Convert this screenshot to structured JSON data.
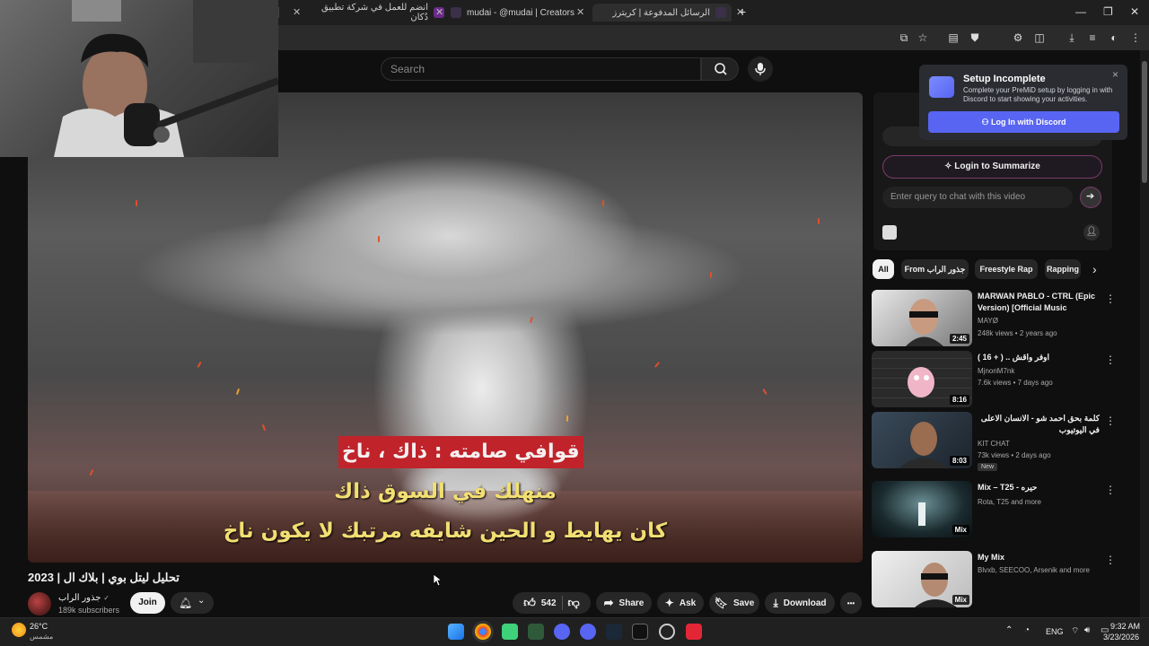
{
  "browser": {
    "tabs": [
      {
        "label": "انضم للعمل في شركة تطبيق دُكان"
      },
      {
        "label": "mudai - @mudai | Creators"
      },
      {
        "label": "الرسائل المدفوعة | كريترز"
      }
    ],
    "new_tab": "+",
    "window_controls": {
      "minimize": "—",
      "maximize": "❐",
      "close": "✕"
    }
  },
  "youtube": {
    "search": {
      "placeholder": "Search"
    }
  },
  "video": {
    "subtitles": {
      "line1": "قوافي صامته : ذاك ، ناخ",
      "line2": "منهلك في السوق ذاك",
      "line3": "كان يهايط و الحين شايفه مرتبك لا يكون ناخ"
    },
    "title": "تحليل ليتل بوي | بلاك ال | 2023",
    "channel": {
      "name": "جذور الراب",
      "subscribers": "189k subscribers",
      "verified": "✓"
    },
    "actions": {
      "join": "Join",
      "likes": "542",
      "share": "Share",
      "ask": "Ask",
      "save": "Save",
      "download": "Download",
      "more": "•••"
    }
  },
  "extension": {
    "login_summarize": "Login to Summarize",
    "chat_placeholder": "Enter query to chat with this video"
  },
  "premid": {
    "title": "Setup Incomplete",
    "description": "Complete your PreMiD setup by logging in with Discord to start showing your activities.",
    "button": "Log In with Discord",
    "close": "×"
  },
  "chips": [
    {
      "label": "All"
    },
    {
      "label": "From جذور الراب"
    },
    {
      "label": "Freestyle Rap"
    },
    {
      "label": "Rapping"
    }
  ],
  "recommendations": [
    {
      "title": "MARWAN PABLO - CTRL (Epic Version) [Official Music Video]...",
      "channel": "MAYØ",
      "meta": "248k views • 2 years ago",
      "duration": "2:45",
      "badge": ""
    },
    {
      "title": "( 16 + ) .. اوفر واقش",
      "channel": "MjnonM7nk",
      "meta": "7.6k views • 7 days ago",
      "duration": "8:16",
      "badge": ""
    },
    {
      "title": "كلمة بحق احمد شو - الانسان الاعلى في اليوتيوب",
      "channel": "KIT CHAT",
      "meta": "73k views • 2 days ago",
      "duration": "8:03",
      "badge": "New"
    },
    {
      "title": "Mix – T25 - حيره",
      "channel": "Rota, T25 and more",
      "meta": "",
      "duration": "Mix",
      "badge": ""
    },
    {
      "title": "My Mix",
      "channel": "Blvxb, SEECOO, Arsenik and more",
      "meta": "",
      "duration": "Mix",
      "badge": ""
    }
  ],
  "taskbar": {
    "weather": {
      "temp": "26°C",
      "desc": "مشمس"
    },
    "lang": "ENG",
    "time": "9:32 AM",
    "date": "3/23/2026"
  },
  "colors": {
    "accent_red": "#c0232a",
    "subtitle_yellow": "#f2df72",
    "discord": "#5865f2"
  }
}
